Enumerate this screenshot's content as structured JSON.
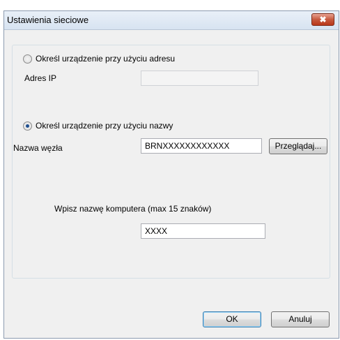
{
  "window": {
    "title": "Ustawienia sieciowe",
    "close_glyph": "✖"
  },
  "address_option": {
    "label": "Określ urządzenie przy użyciu adresu",
    "selected": false,
    "ip_label": "Adres IP",
    "ip_value": ""
  },
  "name_option": {
    "label": "Określ urządzenie przy użyciu nazwy",
    "selected": true,
    "node_label": "Nazwa węzła",
    "node_value": "BRNXXXXXXXXXXXX",
    "browse_label": "Przeglądaj..."
  },
  "computer": {
    "label": "Wpisz nazwę komputera (max 15 znaków)",
    "value": "XXXX"
  },
  "buttons": {
    "ok_label": "OK",
    "cancel_label": "Anuluj"
  }
}
